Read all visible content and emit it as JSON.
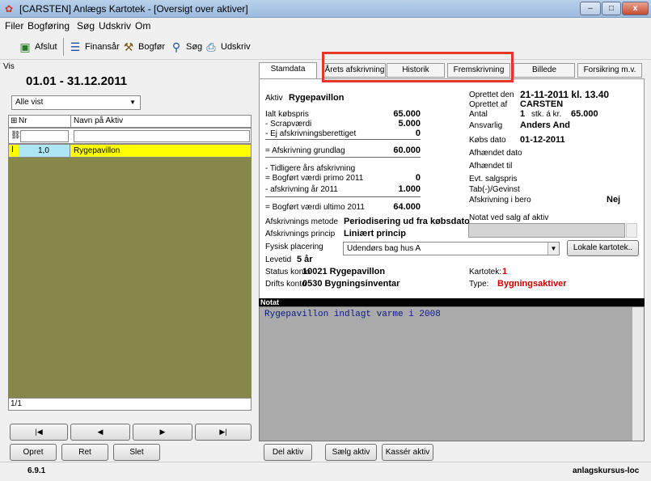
{
  "window": {
    "title": "[CARSTEN] Anlægs Kartotek - [Oversigt over aktiver]",
    "min": "–",
    "max": "□",
    "close": "x"
  },
  "menu": [
    "Filer",
    "Bogføring",
    "Søg",
    "Udskriv",
    "Om"
  ],
  "toolbar": {
    "afslut": "Afslut",
    "finansaar": "Finansår",
    "bogfor": "Bogfør",
    "sog": "Søg",
    "udskriv": "Udskriv"
  },
  "left": {
    "vis_label": "Vis",
    "period": "01.01 - 31.12.2011",
    "filter_value": "Alle vist",
    "col_nr": "Nr",
    "col_name": "Navn på Aktiv",
    "row": {
      "nr": "1,0",
      "name": "Rygepavillon"
    },
    "counter": "1/1",
    "buttons": {
      "opret": "Opret",
      "ret": "Ret",
      "slet": "Slet"
    },
    "nav": [
      "|◀",
      "◀",
      "▶",
      "▶|"
    ]
  },
  "tabs": [
    "Stamdata",
    "Årets afskrivning",
    "Historik",
    "Fremskrivning",
    "Billede",
    "Forsikring m.v."
  ],
  "stamdata": {
    "aktiv_label": "Aktiv",
    "aktiv_name": "Rygepavillon",
    "ialt_label": "Ialt købspris",
    "ialt_val": "65.000",
    "scrap_label": "- Scrapværdi",
    "scrap_val": "5.000",
    "ej_label": "- Ej afskrivningsberettiget",
    "ej_val": "0",
    "grund_label": "= Afskrivning grundlag",
    "grund_val": "60.000",
    "tidl_label": "- Tidligere års afskrivning",
    "primo_label": "= Bogført værdi primo  2011",
    "primo_val": "0",
    "afskr_label": "- afskrivning år  2011",
    "afskr_val": "1.000",
    "ultimo_label": "= Bogført værdi ultimo 2011",
    "ultimo_val": "64.000",
    "metode_label": "Afskrivnings metode",
    "metode_val": "Periodisering ud fra købsdato",
    "princip_label": "Afskrivnings princip",
    "princip_val": "Liniært princip",
    "placering_label": "Fysisk placering",
    "placering_val": "Udendørs bag hus A",
    "levetid_label": "Levetid",
    "levetid_val": "5 år",
    "status_label": "Status konto",
    "status_val": "10021 Rygepavillon",
    "drifts_label": "Drifts konto",
    "drifts_val": "0530 Bygningsinventar",
    "oprettet_den_label": "Oprettet den",
    "oprettet_den_val": "21-11-2011 kl. 13.40",
    "oprettet_af_label": "Oprettet af",
    "oprettet_af_val": "CARSTEN",
    "antal_label": "Antal",
    "antal_val": "1",
    "antal_mid": "stk. á kr.",
    "antal_price": "65.000",
    "ansvarlig_label": "Ansvarlig",
    "ansvarlig_val": "Anders And",
    "kobsdato_label": "Købs dato",
    "kobsdato_val": "01-12-2011",
    "afhaendet_dato": "Afhændet dato",
    "afhaendet_til": "Afhændet til",
    "salgspris": "Evt. salgspris",
    "tab": "Tab(-)/Gevinst",
    "bero_label": "Afskrivning i bero",
    "bero_val": "Nej",
    "notat_salg": "Notat ved salg af aktiv",
    "lokale_btn": "Lokale kartotek..",
    "kartotek_label": "Kartotek:",
    "kartotek_val": "1",
    "type_label": "Type:",
    "type_val": "Bygningsaktiver"
  },
  "notat": {
    "header": "Notat",
    "text": "Rygepavillon indlagt varme i 2008"
  },
  "actions": {
    "del": "Del aktiv",
    "saelg": "Sælg aktiv",
    "kasser": "Kassér aktiv"
  },
  "status": {
    "version": "6.9.1",
    "server": "anlagskursus-loc"
  },
  "colors": {
    "highlight_row": "#ffff00",
    "panel": "#85884a",
    "annotation": "#e83528",
    "type_red": "#cc0000"
  }
}
